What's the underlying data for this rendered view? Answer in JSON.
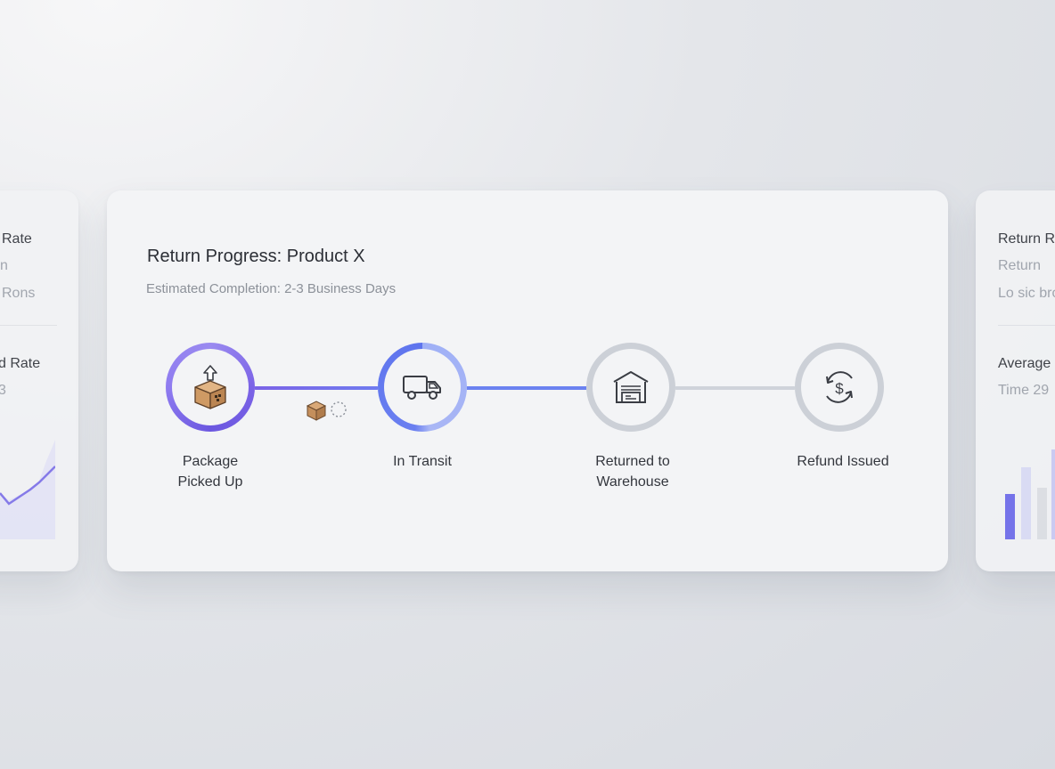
{
  "left_card": {
    "title1": "Rate",
    "sub1a": "n",
    "sub1b": "Rons",
    "title2": "d Rate",
    "sub2": "3"
  },
  "main_card": {
    "title": "Return Progress: Product X",
    "subtitle": "Estimated Completion: 2-3 Business Days",
    "steps": [
      {
        "label_line1": "Package",
        "label_line2": "Picked Up",
        "icon": "package-pickup-icon",
        "status": "completed"
      },
      {
        "label_line1": "In Transit",
        "label_line2": "",
        "icon": "truck-icon",
        "status": "current"
      },
      {
        "label_line1": "Returned to",
        "label_line2": "Warehouse",
        "icon": "warehouse-icon",
        "status": "pending"
      },
      {
        "label_line1": "Refund Issued",
        "label_line2": "",
        "icon": "refund-icon",
        "status": "pending"
      }
    ]
  },
  "right_card": {
    "title1": "Return R",
    "sub1a": "Return",
    "sub1b": "Lo sic bro",
    "title2": "Average",
    "sub2": "Time 29"
  },
  "colors": {
    "accent_purple": "#7b63e6",
    "accent_blue": "#6b7cf0",
    "pending_gray": "#ccd0d7"
  }
}
